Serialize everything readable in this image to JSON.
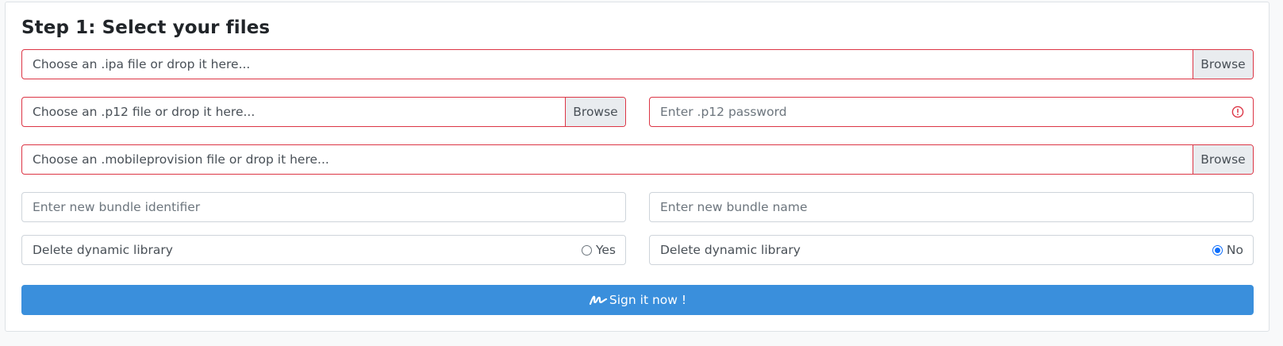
{
  "step_title": "Step 1: Select your files",
  "ipa": {
    "placeholder": "Choose an .ipa file or drop it here...",
    "browse": "Browse"
  },
  "p12": {
    "placeholder": "Choose an .p12 file or drop it here...",
    "browse": "Browse"
  },
  "p12_password": {
    "placeholder": "Enter .p12 password",
    "icon": "exclamation-circle-icon"
  },
  "mobileprovision": {
    "placeholder": "Choose an .mobileprovision file or drop it here...",
    "browse": "Browse"
  },
  "bundle_identifier": {
    "placeholder": "Enter new bundle identifier"
  },
  "bundle_name": {
    "placeholder": "Enter new bundle name"
  },
  "delete_dylib_yes": {
    "label": "Delete dynamic library",
    "option": "Yes",
    "checked": false
  },
  "delete_dylib_no": {
    "label": "Delete dynamic library",
    "option": "No",
    "checked": true
  },
  "sign_button": {
    "label": "Sign it now !",
    "icon": "signature-icon"
  },
  "colors": {
    "invalid_border": "#dc3545",
    "primary_button": "#3a8fdc",
    "radio_checked": "#0d6efd"
  }
}
